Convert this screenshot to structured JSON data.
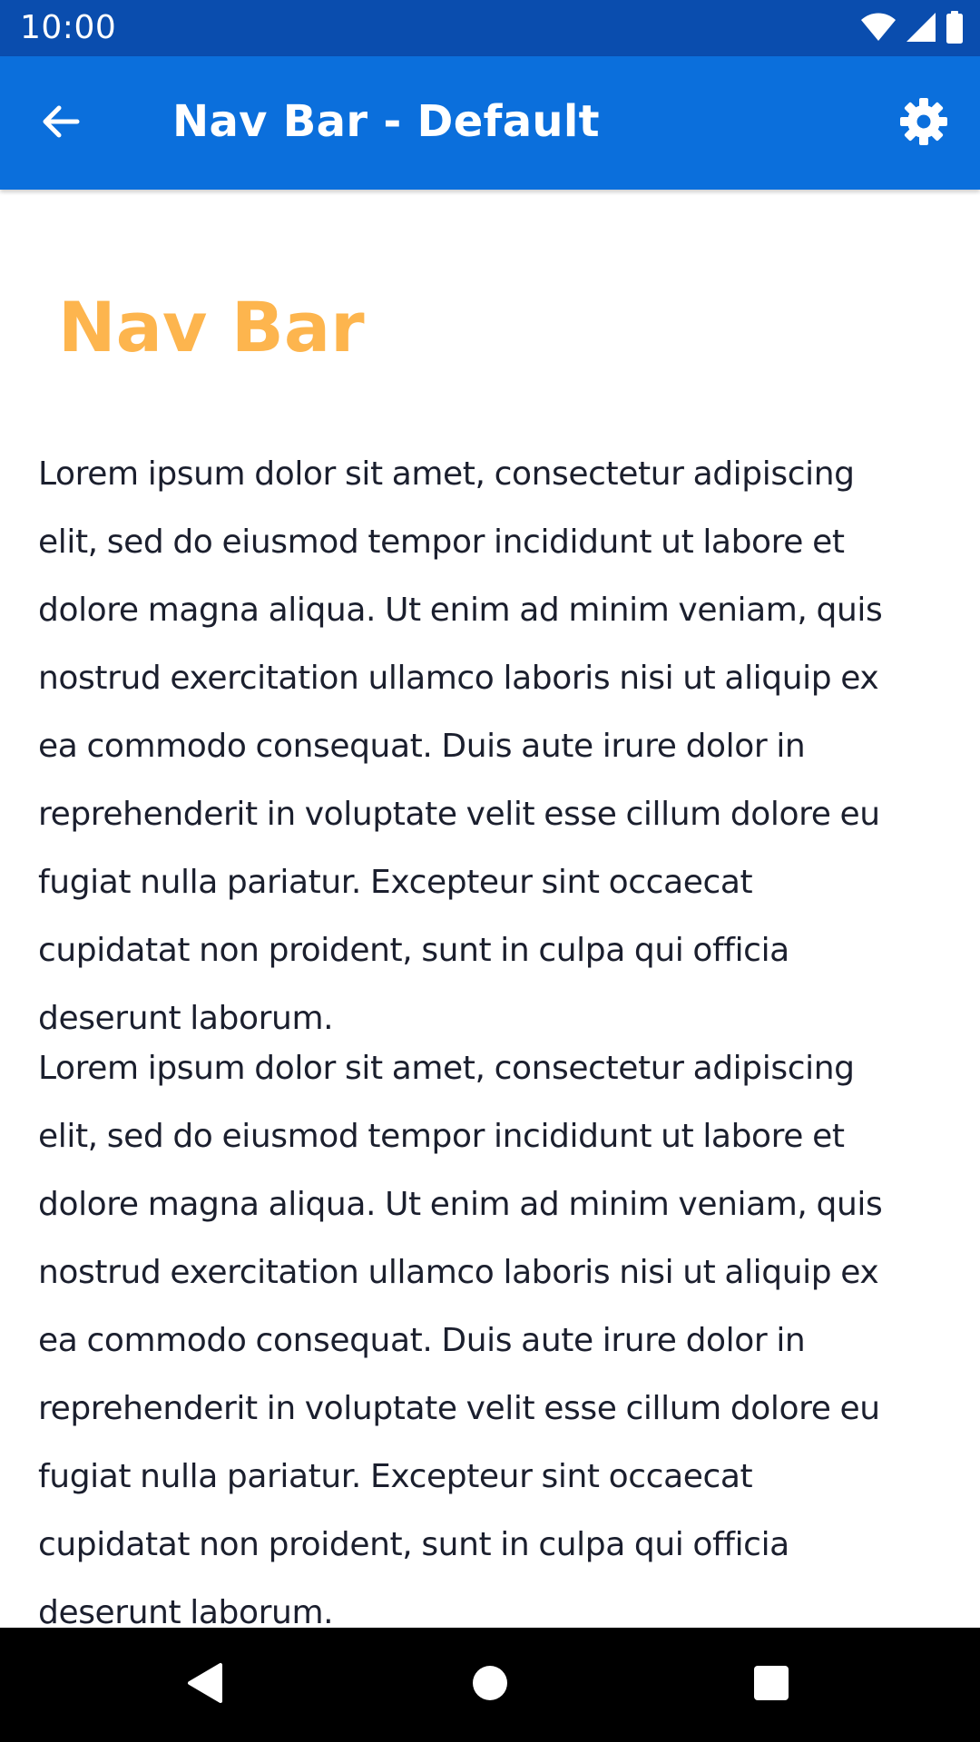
{
  "status_bar": {
    "time": "10:00",
    "icons": [
      "wifi-icon",
      "cell-signal-icon",
      "battery-icon"
    ]
  },
  "app_bar": {
    "title": "Nav Bar - Default",
    "back_icon": "arrow-back-icon",
    "settings_icon": "gear-icon",
    "background_color": "#0B6FDC",
    "status_bar_color": "#0A4DAE"
  },
  "content": {
    "heading": "Nav Bar",
    "heading_color": "#FDB54E",
    "paragraphs": [
      {
        "lines": [
          "Lorem ipsum dolor sit amet, consectetur adipiscing",
          "elit, sed do eiusmod tempor incididunt ut labore et",
          "dolore magna aliqua. Ut enim ad minim veniam, quis",
          "nostrud exercitation ullamco laboris nisi ut aliquip ex",
          "ea commodo consequat. Duis aute irure dolor in",
          "reprehenderit in voluptate velit esse cillum dolore eu",
          "fugiat nulla pariatur. Excepteur sint occaecat",
          "cupidatat non proident, sunt in culpa qui officia",
          "deserunt laborum."
        ]
      },
      {
        "lines": [
          "Lorem ipsum dolor sit amet, consectetur adipiscing",
          "elit, sed do eiusmod tempor incididunt ut labore et",
          "dolore magna aliqua. Ut enim ad minim veniam, quis",
          "nostrud exercitation ullamco laboris nisi ut aliquip ex",
          "ea commodo consequat. Duis aute irure dolor in",
          "reprehenderit in voluptate velit esse cillum dolore eu",
          "fugiat nulla pariatur. Excepteur sint occaecat",
          "cupidatat non proident, sunt in culpa qui officia",
          "deserunt laborum."
        ]
      }
    ]
  },
  "system_nav": {
    "icons": [
      "nav-back-triangle-icon",
      "nav-home-circle-icon",
      "nav-recents-square-icon"
    ]
  }
}
